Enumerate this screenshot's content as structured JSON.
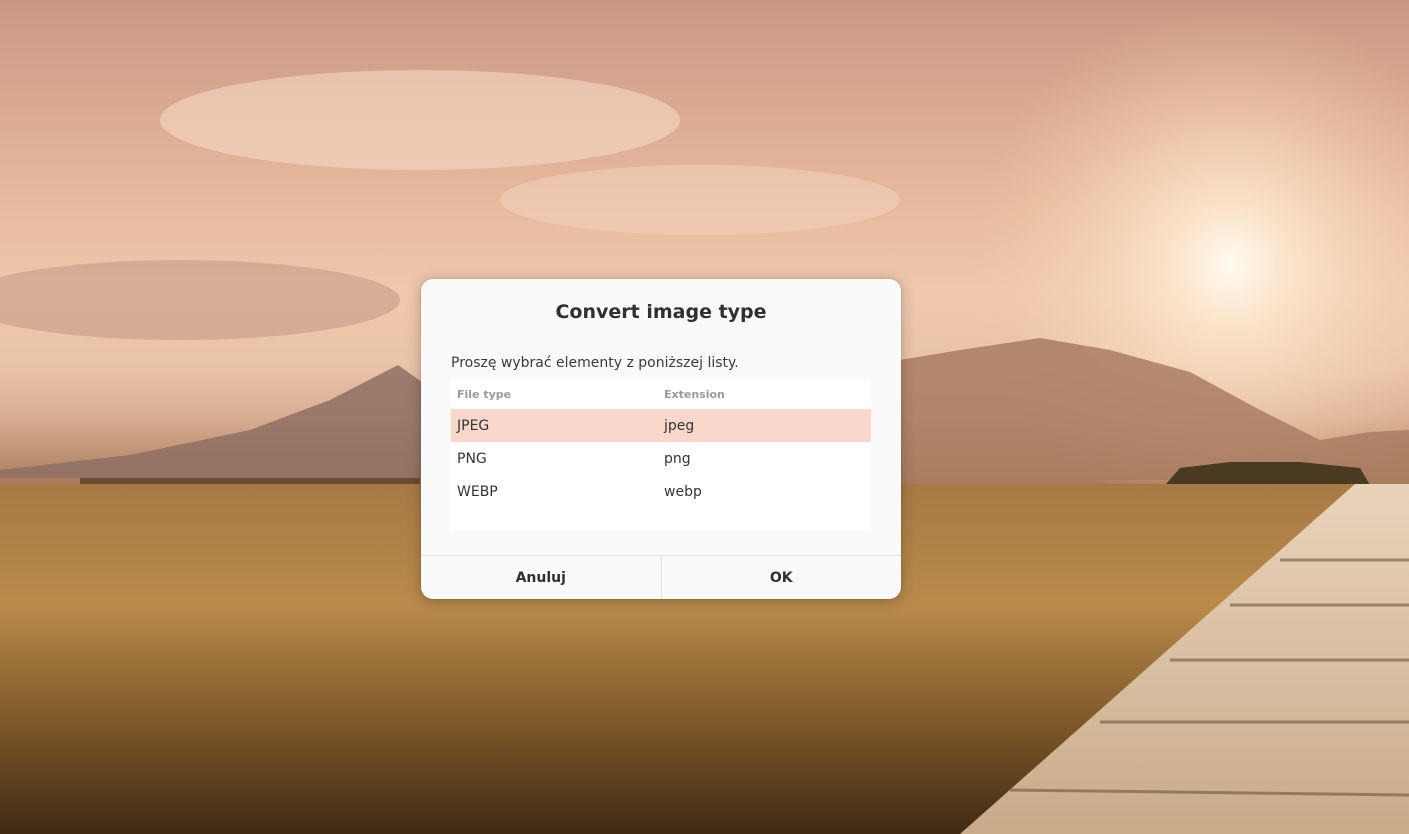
{
  "dialog": {
    "title": "Convert image type",
    "message": "Proszę wybrać elementy z poniższej listy.",
    "columns": [
      "File type",
      "Extension"
    ],
    "rows": [
      {
        "type": "JPEG",
        "extension": "jpeg",
        "selected": true
      },
      {
        "type": "PNG",
        "extension": "png",
        "selected": false
      },
      {
        "type": "WEBP",
        "extension": "webp",
        "selected": false
      }
    ],
    "cancel_label": "Anuluj",
    "ok_label": "OK"
  },
  "colors": {
    "selected_row": "#fad6cb",
    "dialog_bg": "#fafafa"
  }
}
